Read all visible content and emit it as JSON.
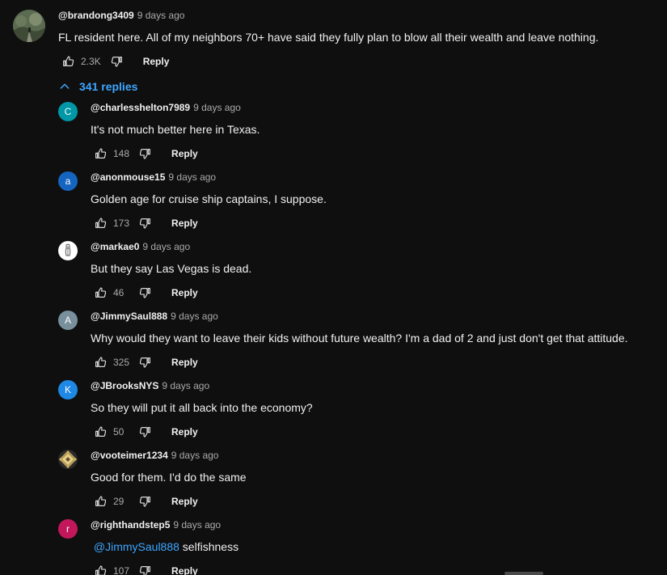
{
  "top_comment": {
    "author": "@brandong3409",
    "time": "9 days ago",
    "text": "FL resident here. All of my neighbors 70+ have said they fully plan to blow all their wealth and leave nothing.",
    "likes": "2.3K",
    "reply_label": "Reply"
  },
  "replies_toggle": {
    "label": "341 replies",
    "icon": "chevron-up-icon"
  },
  "replies": [
    {
      "author": "@charlesshelton7989",
      "time": "9 days ago",
      "text": "It's not much better here in Texas.",
      "likes": "148",
      "reply_label": "Reply",
      "avatar_letter": "C",
      "avatar_color": "#0097a7"
    },
    {
      "author": "@anonmouse15",
      "time": "9 days ago",
      "text": "Golden age for cruise ship captains, I suppose.",
      "likes": "173",
      "reply_label": "Reply",
      "avatar_letter": "a",
      "avatar_color": "#1565c0"
    },
    {
      "author": "@markae0",
      "time": "9 days ago",
      "text": "But they say Las Vegas is dead.",
      "likes": "46",
      "reply_label": "Reply",
      "avatar_letter": "",
      "avatar_color": "#ffffff"
    },
    {
      "author": "@JimmySaul888",
      "time": "9 days ago",
      "text": "Why would they want to leave their kids without future wealth? I'm a dad of 2 and just don't get that attitude.",
      "likes": "325",
      "reply_label": "Reply",
      "avatar_letter": "A",
      "avatar_color": "#78909c"
    },
    {
      "author": "@JBrooksNYS",
      "time": "9 days ago",
      "text": "So they will put it all back into the economy?",
      "likes": "50",
      "reply_label": "Reply",
      "avatar_letter": "K",
      "avatar_color": "#1e88e5"
    },
    {
      "author": "@vooteimer1234",
      "time": "9 days ago",
      "text": "Good for them. I'd do the same",
      "likes": "29",
      "reply_label": "Reply",
      "avatar_letter": "",
      "avatar_color": "#8d6e3f"
    },
    {
      "author": "@righthandstep5",
      "time": "9 days ago",
      "mention": "@JimmySaul888",
      "text": " selfishness",
      "likes": "107",
      "reply_label": "Reply",
      "avatar_letter": "r",
      "avatar_color": "#c2185b"
    }
  ],
  "colors": {
    "background": "#0f0f0f",
    "link": "#3ea6ff",
    "secondary_text": "#aaaaaa"
  }
}
